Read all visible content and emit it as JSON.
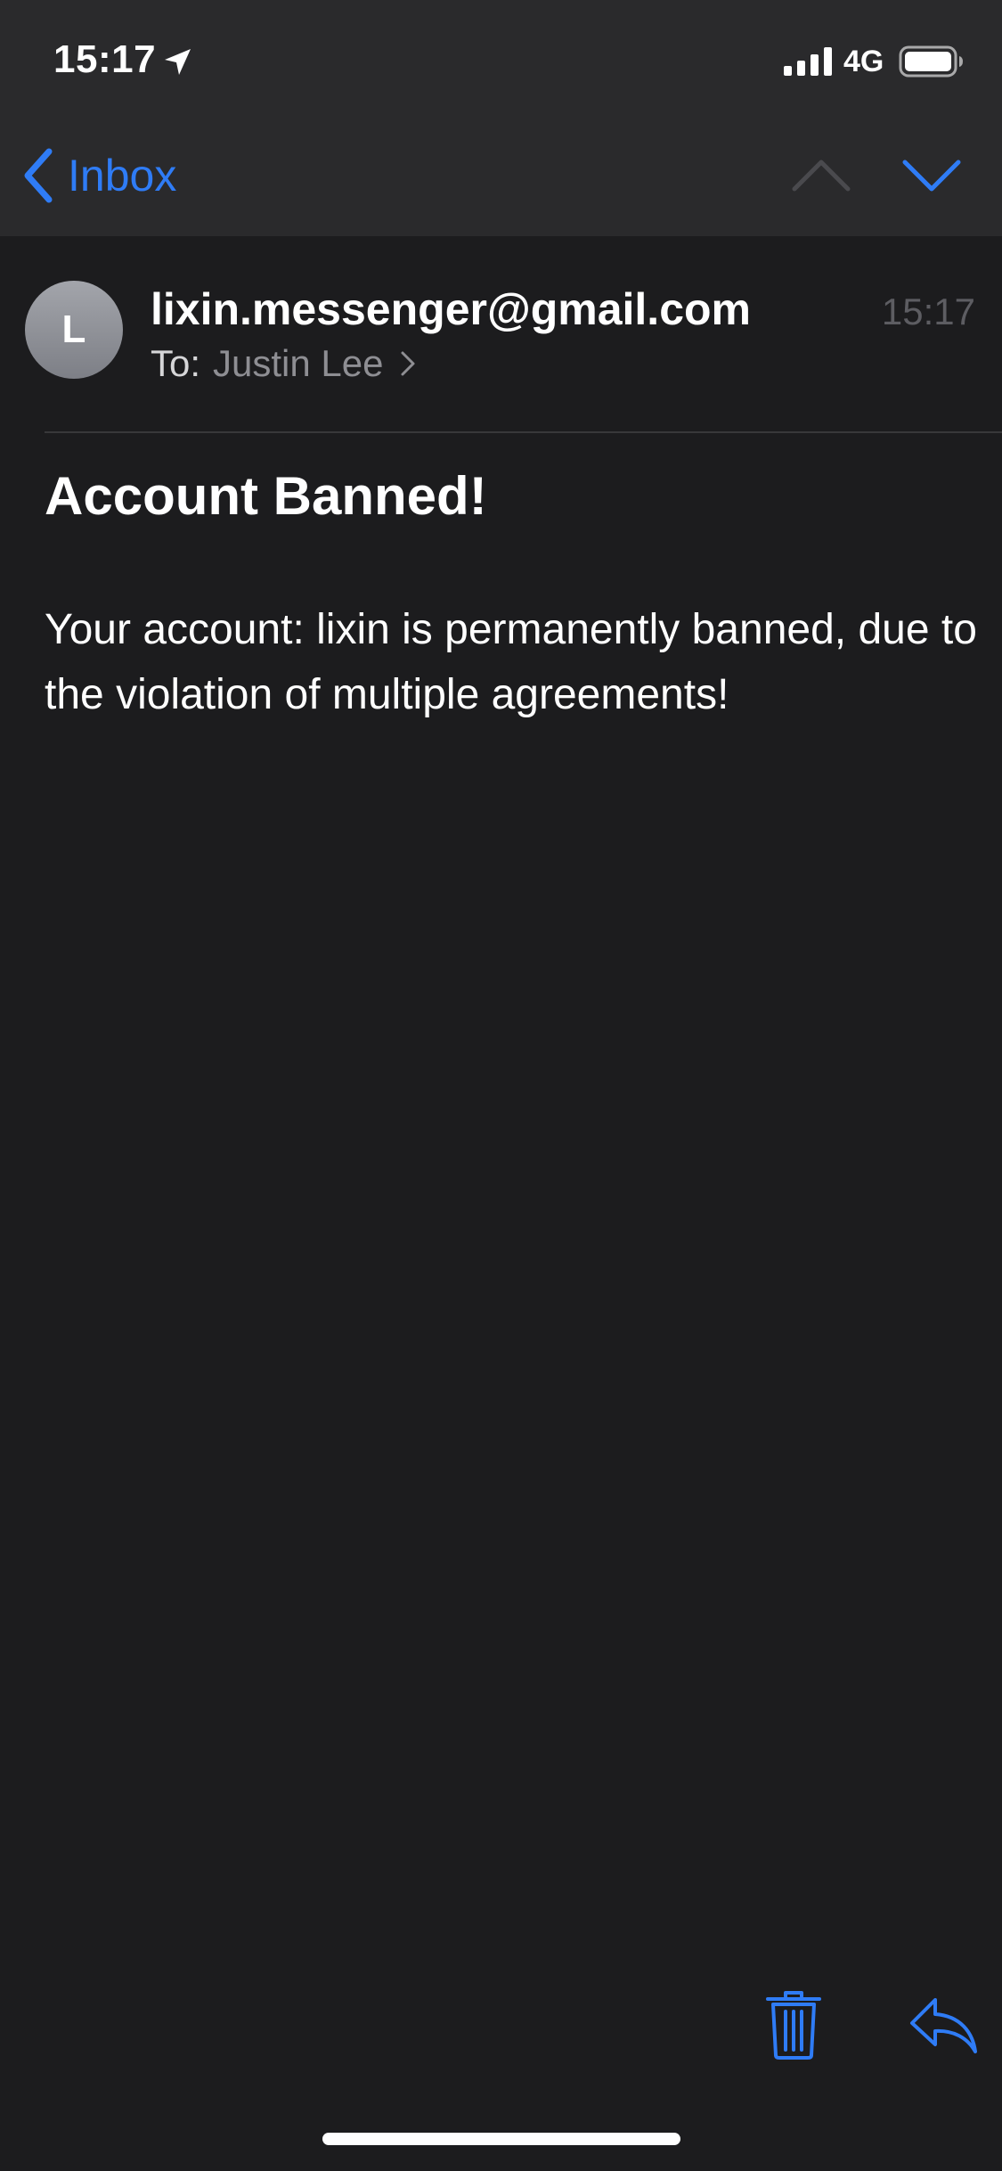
{
  "status_bar": {
    "time": "15:17",
    "network": "4G",
    "icons": [
      "location-arrow-icon",
      "signal-bars-icon",
      "battery-icon"
    ]
  },
  "nav": {
    "back_label": "Inbox",
    "icons": [
      "chevron-left-icon",
      "chevron-up-icon",
      "chevron-down-icon"
    ]
  },
  "message": {
    "avatar_initial": "L",
    "sender": "lixin.messenger@gmail.com",
    "time": "15:17",
    "to_label": "To:",
    "recipient": "Justin Lee",
    "subject": "Account Banned!",
    "body": "Your account: lixin is permanently banned, due to the violation of multiple agreements!"
  },
  "toolbar": {
    "icons": [
      "trash-icon",
      "reply-icon"
    ]
  },
  "colors": {
    "accent": "#2f7cf6",
    "background": "#1c1c1e",
    "header_background": "#2a2a2c",
    "secondary_text": "#8e8e93",
    "disabled": "#5d5d62"
  }
}
